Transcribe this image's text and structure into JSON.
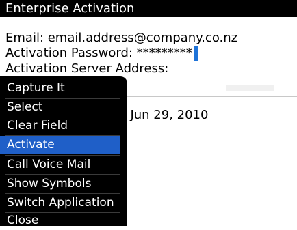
{
  "window": {
    "title": "Enterprise Activation"
  },
  "form": {
    "email_line": "Email: email.address@company.co.nz",
    "password_line": "Activation Password: *********",
    "server_line": "Activation Server Address:",
    "date_line": "Jn Jun 29, 2010"
  },
  "menu": {
    "items": [
      {
        "label": "Capture It"
      },
      {
        "label": "Select"
      },
      {
        "label": "Clear Field"
      },
      {
        "label": "Activate",
        "selected": true
      },
      {
        "label": "Call Voice Mail"
      },
      {
        "label": "Show Symbols"
      },
      {
        "label": "Switch Application"
      },
      {
        "label": "Close"
      }
    ]
  },
  "colors": {
    "titlebar_bg": "#000000",
    "menu_bg": "#000000",
    "selection": "#1f5fc8",
    "cursor": "#1e73d8"
  }
}
